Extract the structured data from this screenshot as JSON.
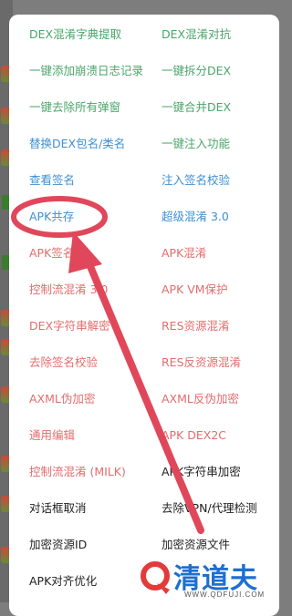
{
  "menu": {
    "rows": [
      [
        {
          "label": "DEX混淆字典提取",
          "color": "green"
        },
        {
          "label": "DEX混淆对抗",
          "color": "green"
        }
      ],
      [
        {
          "label": "一键添加崩溃日志记录",
          "color": "green"
        },
        {
          "label": "一键拆分DEX",
          "color": "green"
        }
      ],
      [
        {
          "label": "一键去除所有弹窗",
          "color": "green"
        },
        {
          "label": "一键合并DEX",
          "color": "green"
        }
      ],
      [
        {
          "label": "替换DEX包名/类名",
          "color": "blue"
        },
        {
          "label": "一键注入功能",
          "color": "green"
        }
      ],
      [
        {
          "label": "查看签名",
          "color": "blue"
        },
        {
          "label": "注入签名校验",
          "color": "blue"
        }
      ],
      [
        {
          "label": "APK共存",
          "color": "blue"
        },
        {
          "label": "超级混淆 3.0",
          "color": "blue"
        }
      ],
      [
        {
          "label": "APK签名",
          "color": "red"
        },
        {
          "label": "APK混淆",
          "color": "red"
        }
      ],
      [
        {
          "label": "控制流混淆 3.0",
          "color": "red"
        },
        {
          "label": "APK VM保护",
          "color": "red"
        }
      ],
      [
        {
          "label": "DEX字符串解密",
          "color": "red"
        },
        {
          "label": "RES资源混淆",
          "color": "red"
        }
      ],
      [
        {
          "label": "去除签名校验",
          "color": "red"
        },
        {
          "label": "RES反资源混淆",
          "color": "red"
        }
      ],
      [
        {
          "label": "AXML伪加密",
          "color": "red"
        },
        {
          "label": "AXML反伪加密",
          "color": "red"
        }
      ],
      [
        {
          "label": "通用编辑",
          "color": "red"
        },
        {
          "label": "APK DEX2C",
          "color": "red"
        }
      ],
      [
        {
          "label": "控制流混淆 (MILK)",
          "color": "red"
        },
        {
          "label": "APK字符串加密",
          "color": "black"
        }
      ],
      [
        {
          "label": "对话框取消",
          "color": "black"
        },
        {
          "label": "去除VPN/代理检测",
          "color": "black"
        }
      ],
      [
        {
          "label": "加密资源ID",
          "color": "black"
        },
        {
          "label": "加密资源文件",
          "color": "black"
        }
      ],
      [
        {
          "label": "APK对齐优化",
          "color": "black"
        },
        {
          "label": "",
          "color": "black"
        }
      ]
    ]
  },
  "annotation": {
    "color": "#e0475a"
  },
  "watermark": {
    "text": "清道夫",
    "url": "WWW.QDFUJI.COM"
  }
}
